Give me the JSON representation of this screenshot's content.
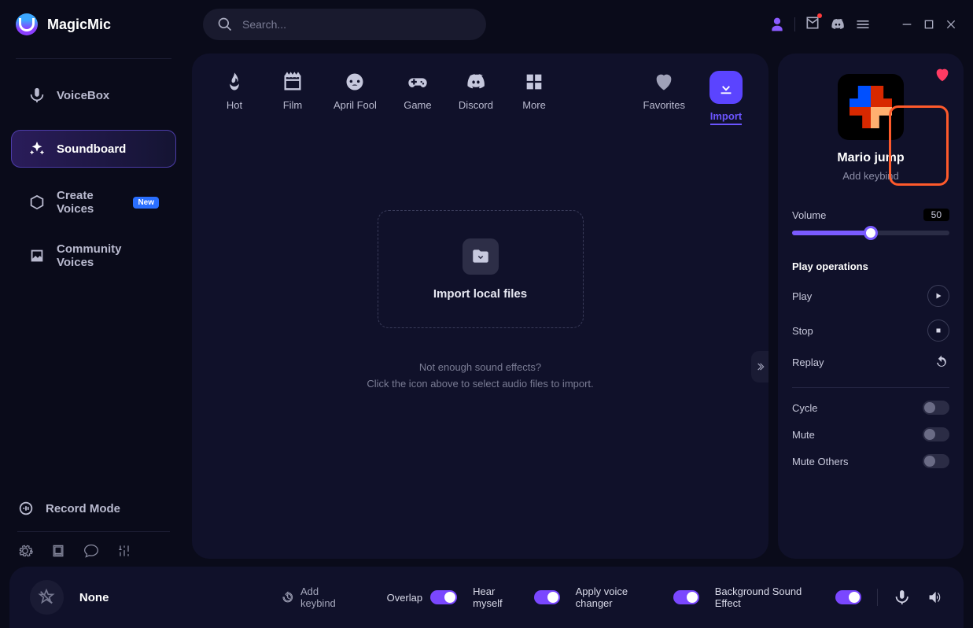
{
  "app": {
    "name": "MagicMic"
  },
  "search": {
    "placeholder": "Search..."
  },
  "sidebar": {
    "items": [
      {
        "label": "VoiceBox"
      },
      {
        "label": "Soundboard"
      },
      {
        "label": "Create Voices",
        "badge": "New"
      },
      {
        "label": "Community Voices"
      }
    ],
    "record": "Record Mode"
  },
  "categories": {
    "hot": "Hot",
    "film": "Film",
    "april_fool": "April Fool",
    "game": "Game",
    "discord": "Discord",
    "more": "More",
    "favorites": "Favorites",
    "import": "Import"
  },
  "dropzone": {
    "title": "Import local files",
    "hint1": "Not enough sound effects?",
    "hint2": "Click the icon above to select audio files to import."
  },
  "panel": {
    "sound_name": "Mario jump",
    "add_keybind": "Add keybind",
    "volume_label": "Volume",
    "volume_value": "50",
    "section_title": "Play operations",
    "ops": {
      "play": "Play",
      "stop": "Stop",
      "replay": "Replay"
    },
    "toggles": {
      "cycle": "Cycle",
      "mute": "Mute",
      "mute_others": "Mute Others"
    }
  },
  "footer": {
    "effect": "None",
    "add_keybind": "Add keybind",
    "overlap": "Overlap",
    "hear_myself": "Hear myself",
    "apply_vc": "Apply voice changer",
    "bg_sound": "Background Sound Effect"
  }
}
